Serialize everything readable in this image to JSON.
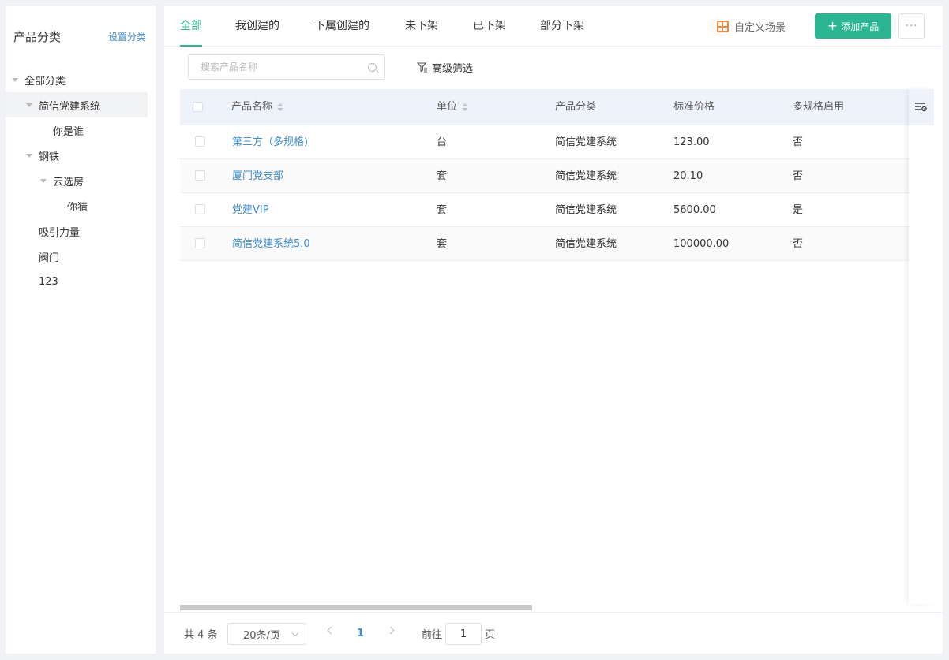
{
  "sidebar": {
    "title": "产品分类",
    "settings_link": "设置分类",
    "tree": [
      {
        "label": "全部分类",
        "level": 0,
        "expanded": true
      },
      {
        "label": "简信党建系统",
        "level": 1,
        "expanded": true,
        "selected": true
      },
      {
        "label": "你是谁",
        "level": 2
      },
      {
        "label": "钢铁",
        "level": 1,
        "expanded": true
      },
      {
        "label": "云选房",
        "level": 2,
        "expanded": true
      },
      {
        "label": "你猜",
        "level": 3
      },
      {
        "label": "吸引力量",
        "level": 1
      },
      {
        "label": "阀门",
        "level": 1
      },
      {
        "label": "123",
        "level": 1
      }
    ]
  },
  "tabs": [
    {
      "label": "全部",
      "active": true
    },
    {
      "label": "我创建的"
    },
    {
      "label": "下属创建的"
    },
    {
      "label": "未下架"
    },
    {
      "label": "已下架"
    },
    {
      "label": "部分下架"
    }
  ],
  "toolbar": {
    "custom_scene": "自定义场景",
    "add_product": "添加产品",
    "more": "···"
  },
  "filter": {
    "search_placeholder": "搜索产品名称",
    "advanced": "高级筛选"
  },
  "table": {
    "columns": [
      "产品名称",
      "单位",
      "产品分类",
      "标准价格",
      "多规格启用"
    ],
    "rows": [
      {
        "name": "第三方（多规格)",
        "unit": "台",
        "category": "简信党建系统",
        "price": "123.00",
        "multi_spec": "否"
      },
      {
        "name": "厦门党支部",
        "unit": "套",
        "category": "简信党建系统",
        "price": "20.10",
        "multi_spec": "否"
      },
      {
        "name": "党建VIP",
        "unit": "套",
        "category": "简信党建系统",
        "price": "5600.00",
        "multi_spec": "是"
      },
      {
        "name": "简信党建系统5.0",
        "unit": "套",
        "category": "简信党建系统",
        "price": "100000.00",
        "multi_spec": "否"
      }
    ]
  },
  "pagination": {
    "total": "共 4 条",
    "page_size": "20条/页",
    "current_page": "1",
    "goto_label": "前往",
    "goto_value": "1",
    "goto_suffix": "页"
  }
}
